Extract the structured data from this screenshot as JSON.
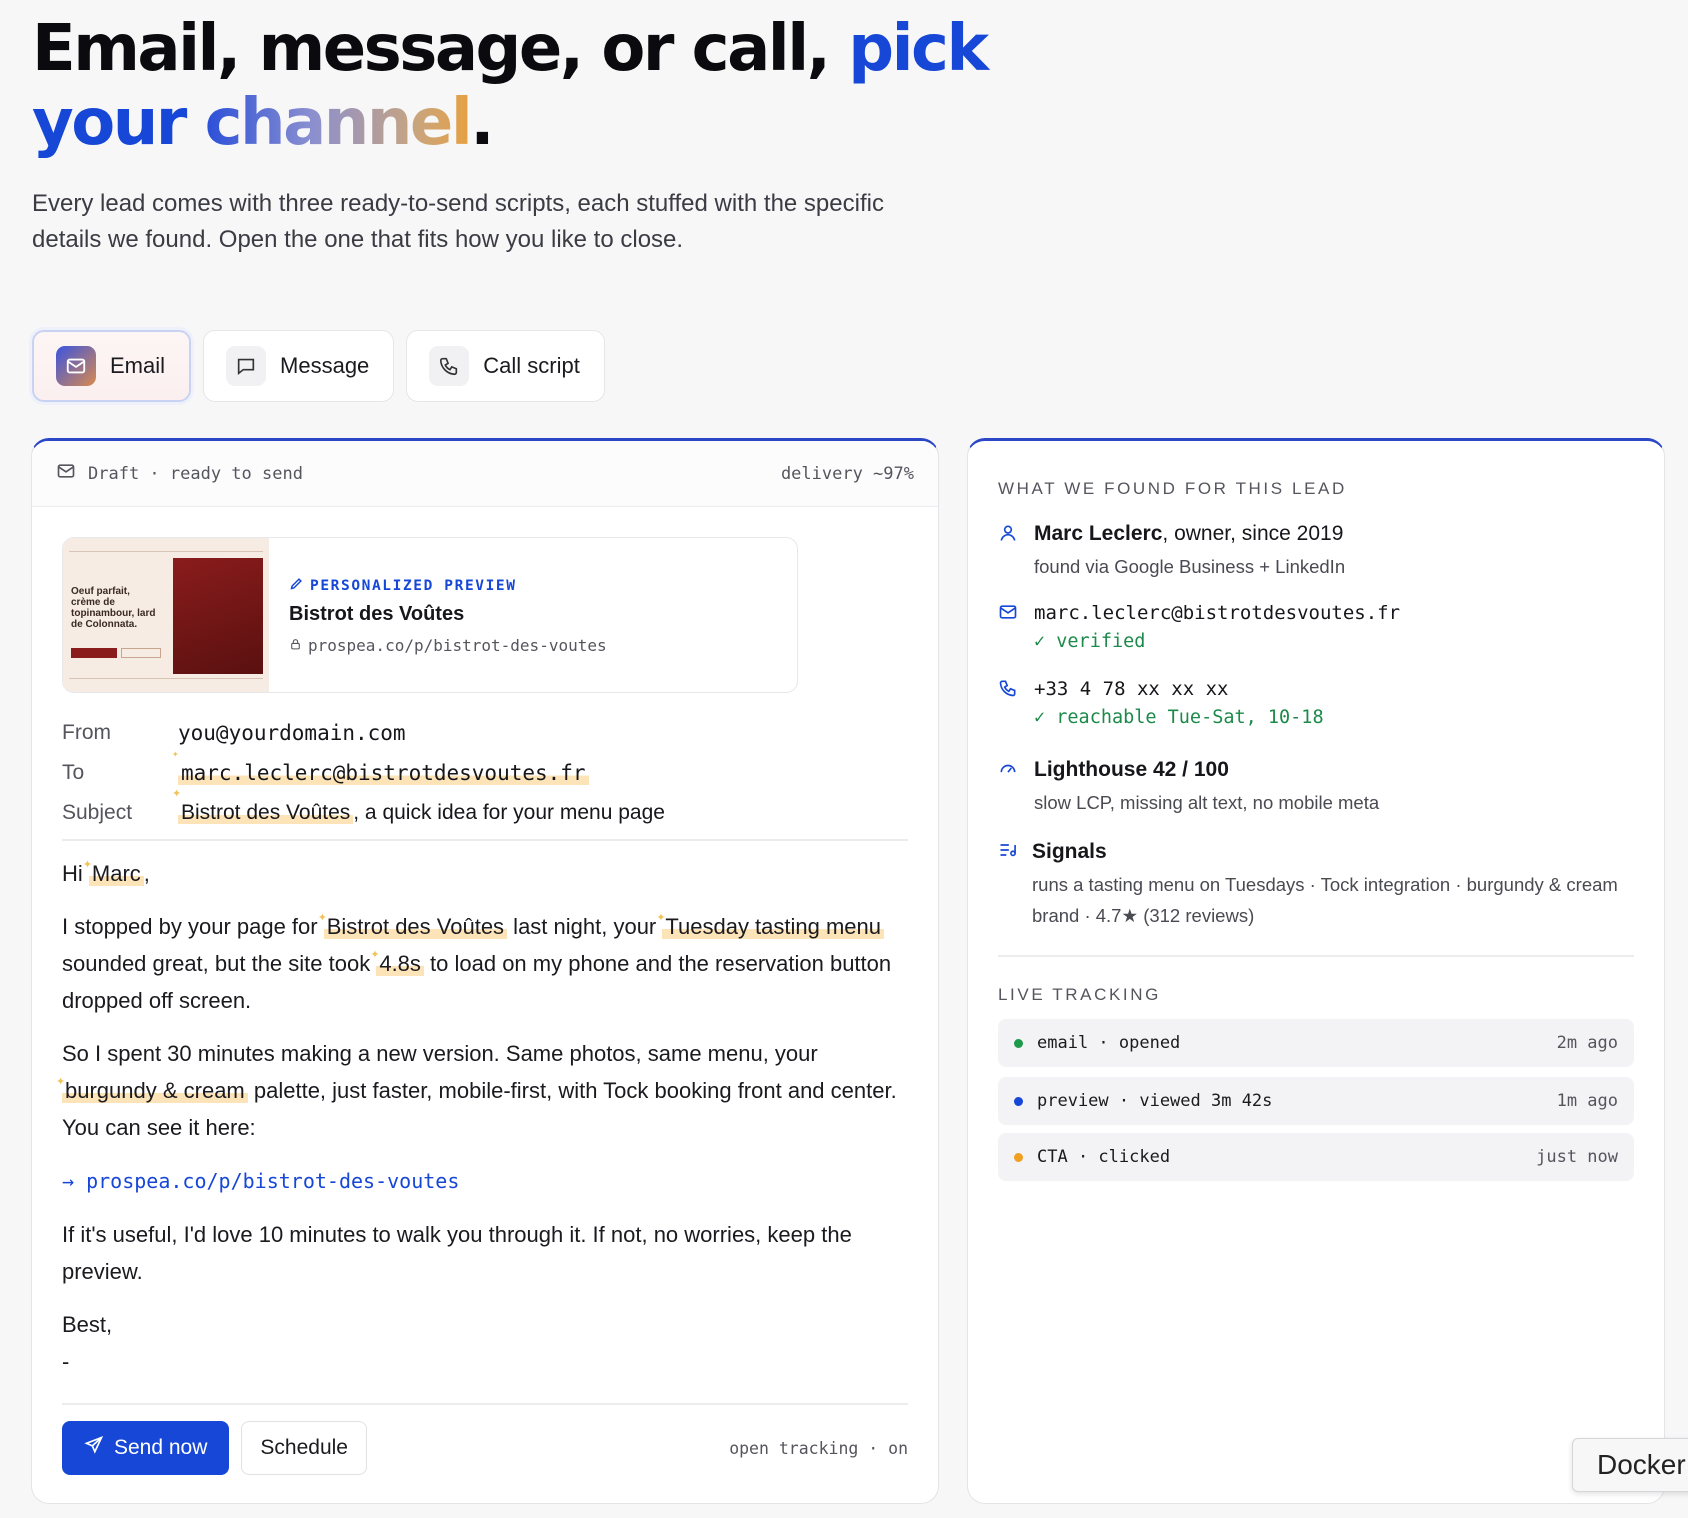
{
  "hero": {
    "title_a": "Email, message, or call, ",
    "title_pick": "pick",
    "title_your": "your ",
    "title_channel": "channel",
    "title_dot": ".",
    "subtitle": "Every lead comes with three ready-to-send scripts, each stuffed with the specific details we found. Open the one that fits how you like to close."
  },
  "tabs": [
    {
      "label": "Email",
      "icon": "mail-icon",
      "active": true
    },
    {
      "label": "Message",
      "icon": "chat-bubble-icon",
      "active": false
    },
    {
      "label": "Call script",
      "icon": "phone-icon",
      "active": false
    }
  ],
  "draft": {
    "status": "Draft · ready to send",
    "delivery": "delivery ~97%",
    "preview": {
      "tag": "PERSONALIZED PREVIEW",
      "name": "Bistrot des Voûtes",
      "url": "prospea.co/p/bistrot-des-voutes",
      "thumb_text": "Oeuf parfait, crème de topinambour, lard de Colonnata."
    },
    "from_label": "From",
    "from_value": "you@yourdomain.com",
    "to_label": "To",
    "to_value": "marc.leclerc@bistrotdesvoutes.fr",
    "subject_label": "Subject",
    "subject_hl": "Bistrot des Voûtes",
    "subject_rest": ", a quick idea for your menu page",
    "body": {
      "greet_a": "Hi ",
      "greet_name": "Marc",
      "greet_b": ",",
      "p1_a": "I stopped by your page for ",
      "p1_hl1": "Bistrot des Voûtes",
      "p1_b": " last night, your ",
      "p1_hl2": "Tuesday tasting menu",
      "p1_c": " sounded great, but the site took ",
      "p1_hl3": "4.8s",
      "p1_d": " to load on my phone and the reservation button dropped off screen.",
      "p2_a": "So I spent 30 minutes making a new version. Same photos, same menu, your ",
      "p2_hl": "burgundy & cream",
      "p2_b": " palette, just faster, mobile-first, with Tock booking front and center. You can see it here:",
      "link": "→ prospea.co/p/bistrot-des-voutes",
      "p3": "If it's useful, I'd love 10 minutes to walk you through it. If not, no worries, keep the preview.",
      "signoff": "Best,",
      "sig": "-"
    },
    "send_label": "Send now",
    "schedule_label": "Schedule",
    "tracking": "open tracking · on"
  },
  "found": {
    "heading": "WHAT WE FOUND FOR THIS LEAD",
    "person_name": "Marc Leclerc",
    "person_role": ", owner, since 2019",
    "person_source": "found via Google Business + LinkedIn",
    "email": "marc.leclerc@bistrotdesvoutes.fr",
    "email_status": "✓ verified",
    "phone": "+33 4 78 xx xx xx",
    "phone_status": "✓ reachable Tue-Sat, 10-18",
    "lighthouse": "Lighthouse 42 / 100",
    "lighthouse_detail": "slow LCP, missing alt text, no mobile meta",
    "signals_title": "Signals",
    "signals_detail": "runs a tasting menu on Tuesdays · Tock integration · burgundy & cream brand · 4.7★ (312 reviews)"
  },
  "tracking": {
    "heading": "LIVE TRACKING",
    "rows": [
      {
        "event": "email · opened",
        "ago": "2m ago",
        "color": "#1c9a4a"
      },
      {
        "event": "preview · viewed 3m 42s",
        "ago": "1m ago",
        "color": "#1747d6"
      },
      {
        "event": "CTA · clicked",
        "ago": "just now",
        "color": "#f0a020"
      }
    ]
  },
  "docker_label": "Docker"
}
